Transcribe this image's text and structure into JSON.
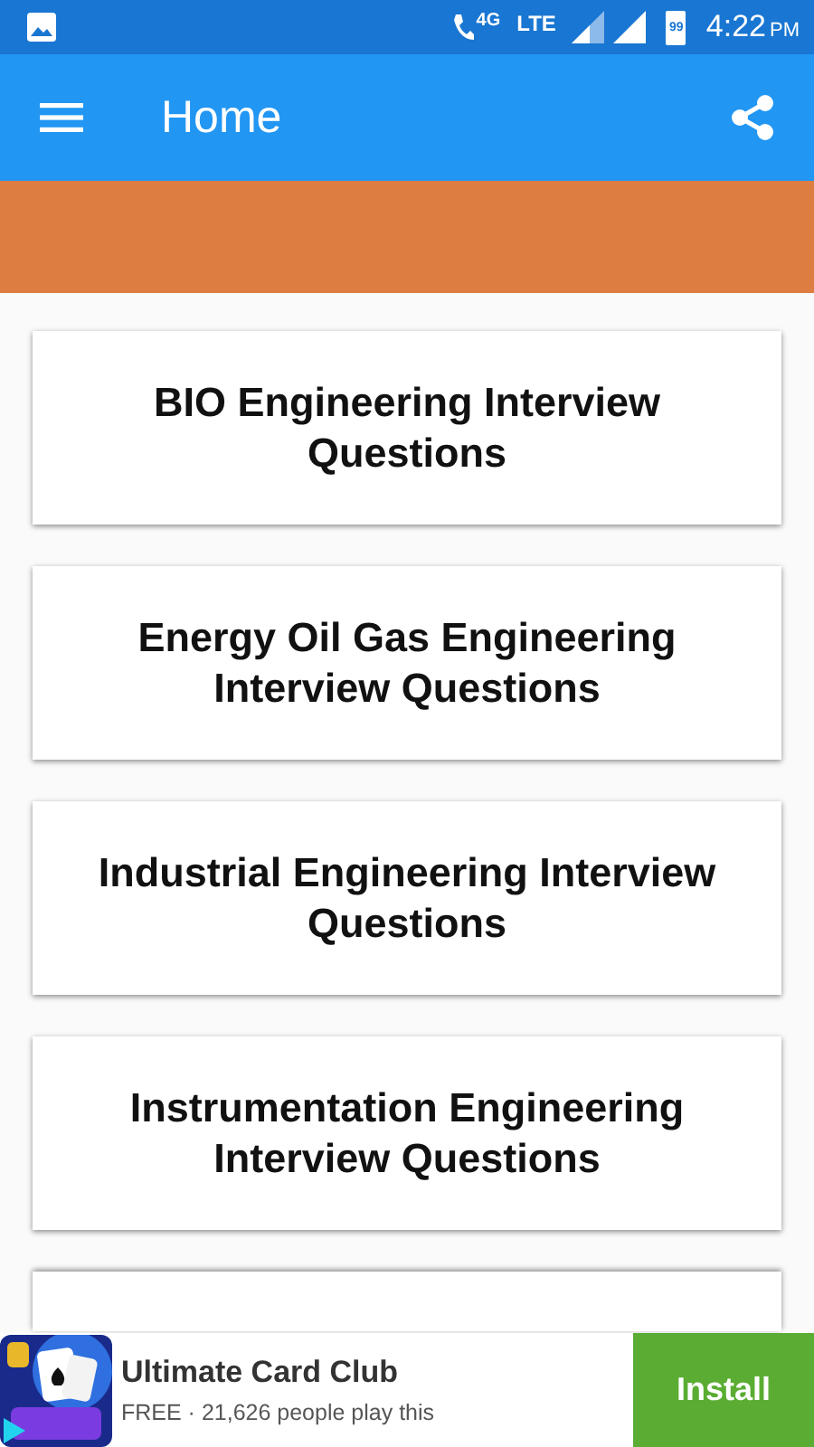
{
  "status_bar": {
    "network": "4G",
    "lte": "LTE",
    "battery": "99",
    "time": "4:22",
    "ampm": "PM"
  },
  "toolbar": {
    "title": "Home"
  },
  "cards": [
    {
      "kind": "full",
      "title": "BIO Engineering Interview Questions"
    },
    {
      "kind": "full",
      "title": "Energy Oil Gas Engineering Interview Questions"
    },
    {
      "kind": "full",
      "title": "Industrial Engineering Interview Questions"
    },
    {
      "kind": "full",
      "title": "Instrumentation Engineering Interview Questions"
    },
    {
      "kind": "cut"
    }
  ],
  "ad": {
    "app_name": "Ultimate Card Club",
    "subtitle": "FREE · 21,626 people play this",
    "button": "Install"
  }
}
